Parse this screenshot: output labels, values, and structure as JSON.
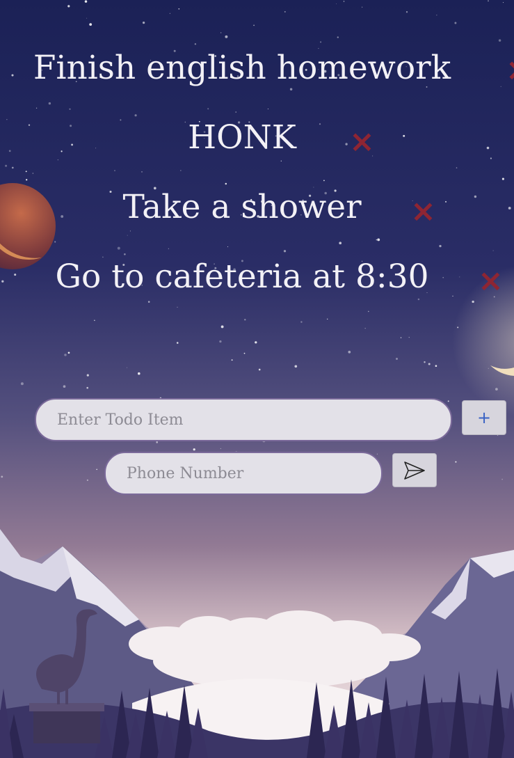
{
  "todos": [
    {
      "text": "Finish english homework"
    },
    {
      "text": "HONK"
    },
    {
      "text": "Take a shower"
    },
    {
      "text": "Go to cafeteria at 8:30"
    }
  ],
  "form": {
    "todo_placeholder": "Enter Todo Item",
    "add_symbol": "+",
    "phone_placeholder": "Phone Number"
  },
  "icons": {
    "delete": "close-icon",
    "add": "plus-icon",
    "send": "paper-plane-icon"
  },
  "colors": {
    "delete_x": "#8e2533",
    "add_plus": "#3a62c4",
    "input_bg": "#e3e1e8",
    "input_border": "#7b6a9a"
  }
}
